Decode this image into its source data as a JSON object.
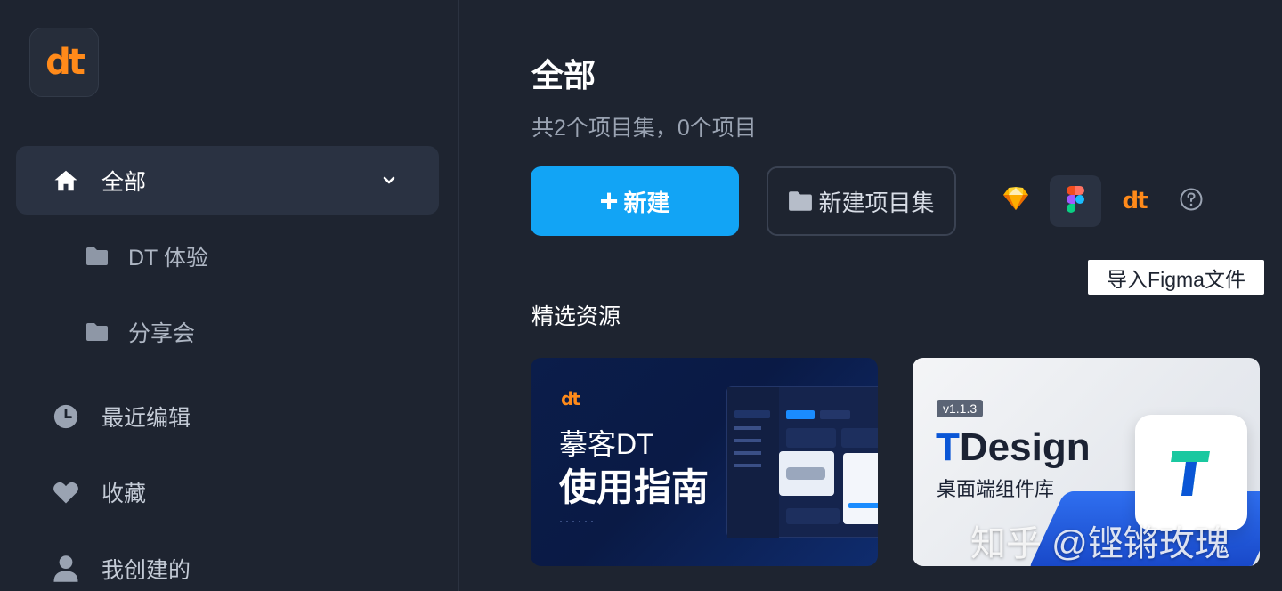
{
  "sidebar": {
    "logo_text": "dt",
    "items": [
      {
        "label": "全部",
        "icon": "home-icon",
        "expanded": true
      },
      {
        "label": "DT 体验",
        "icon": "folder-icon"
      },
      {
        "label": "分享会",
        "icon": "folder-icon"
      },
      {
        "label": "最近编辑",
        "icon": "clock-icon"
      },
      {
        "label": "收藏",
        "icon": "heart-icon"
      },
      {
        "label": "我创建的",
        "icon": "user-icon"
      }
    ]
  },
  "main": {
    "title": "全部",
    "subtitle": "共2个项目集，0个项目",
    "new_button": "新建",
    "new_folder_button": "新建项目集",
    "tools": {
      "sketch_icon": "sketch-icon",
      "figma_icon": "figma-icon",
      "dt_label": "dt",
      "help_icon": "help-icon"
    },
    "tooltip": "导入Figma文件",
    "section_title": "精选资源",
    "cards": [
      {
        "logo": "dt",
        "line1": "摹客DT",
        "line2": "使用指南",
        "dots": "······"
      },
      {
        "badge": "v1.1.3",
        "title_t": "T",
        "title_rest": "Design",
        "subtitle": "桌面端组件库"
      }
    ]
  },
  "watermark": "知乎 @铿锵玫瑰",
  "colors": {
    "background": "#1e2430",
    "primary": "#12a4f5",
    "brand_orange": "#ff8a1a",
    "active_bg": "#2a3242"
  }
}
